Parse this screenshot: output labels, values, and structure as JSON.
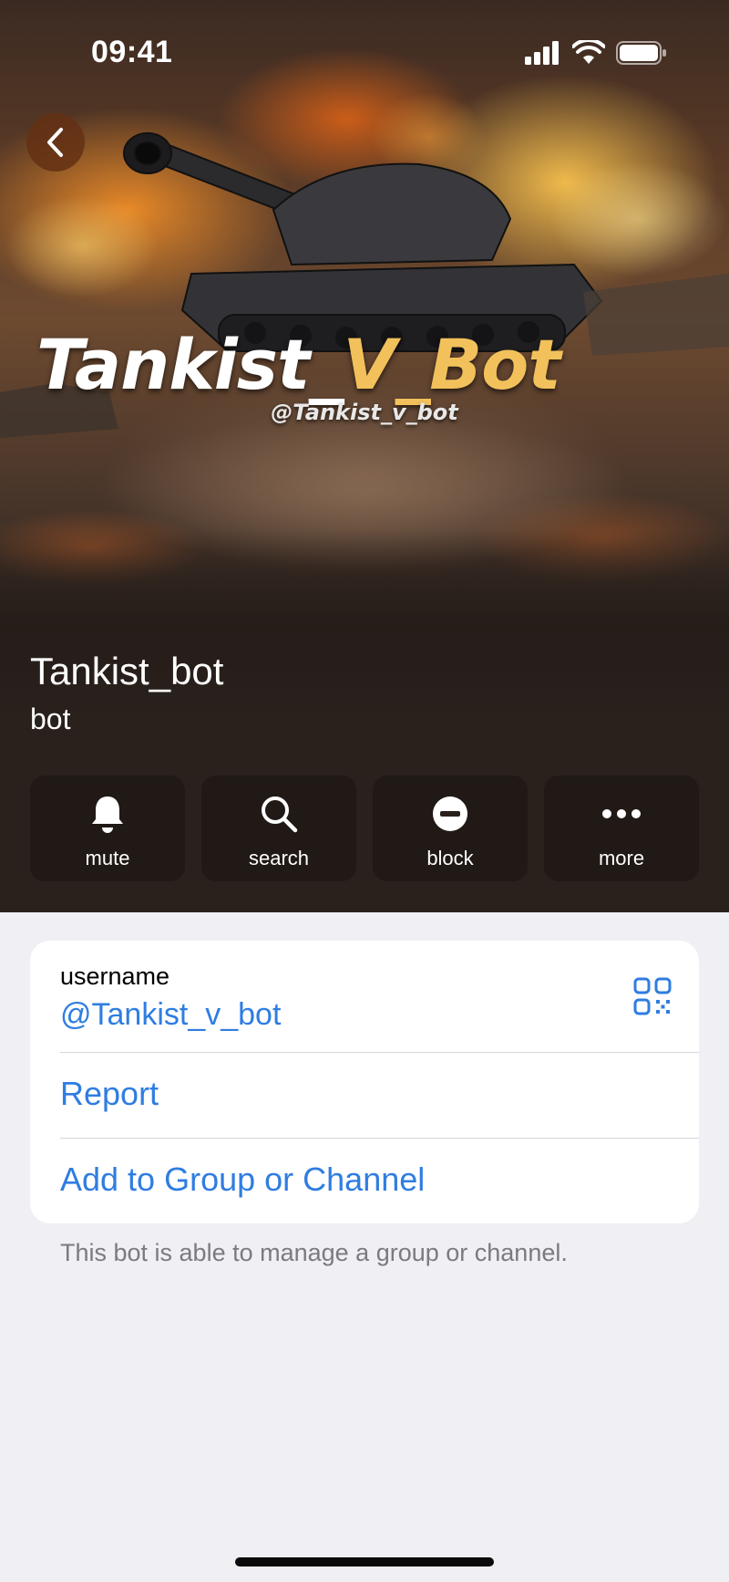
{
  "status_bar": {
    "time": "09:41"
  },
  "hero": {
    "art_title_white": "Tankist_",
    "art_title_gold": "V_Bot",
    "art_handle": "@Tankist_v_bot"
  },
  "profile": {
    "name": "Tankist_bot",
    "subtitle": "bot"
  },
  "actions": [
    {
      "label": "mute",
      "icon": "bell-icon"
    },
    {
      "label": "search",
      "icon": "search-icon"
    },
    {
      "label": "block",
      "icon": "block-icon"
    },
    {
      "label": "more",
      "icon": "more-icon"
    }
  ],
  "info": {
    "username_label": "username",
    "username_value": "@Tankist_v_bot",
    "report_label": "Report",
    "add_label": "Add to Group or Channel"
  },
  "footnote": "This bot is able to manage a group or channel.",
  "colors": {
    "link": "#2f7de1",
    "background": "#efeff4",
    "card": "#ffffff"
  }
}
